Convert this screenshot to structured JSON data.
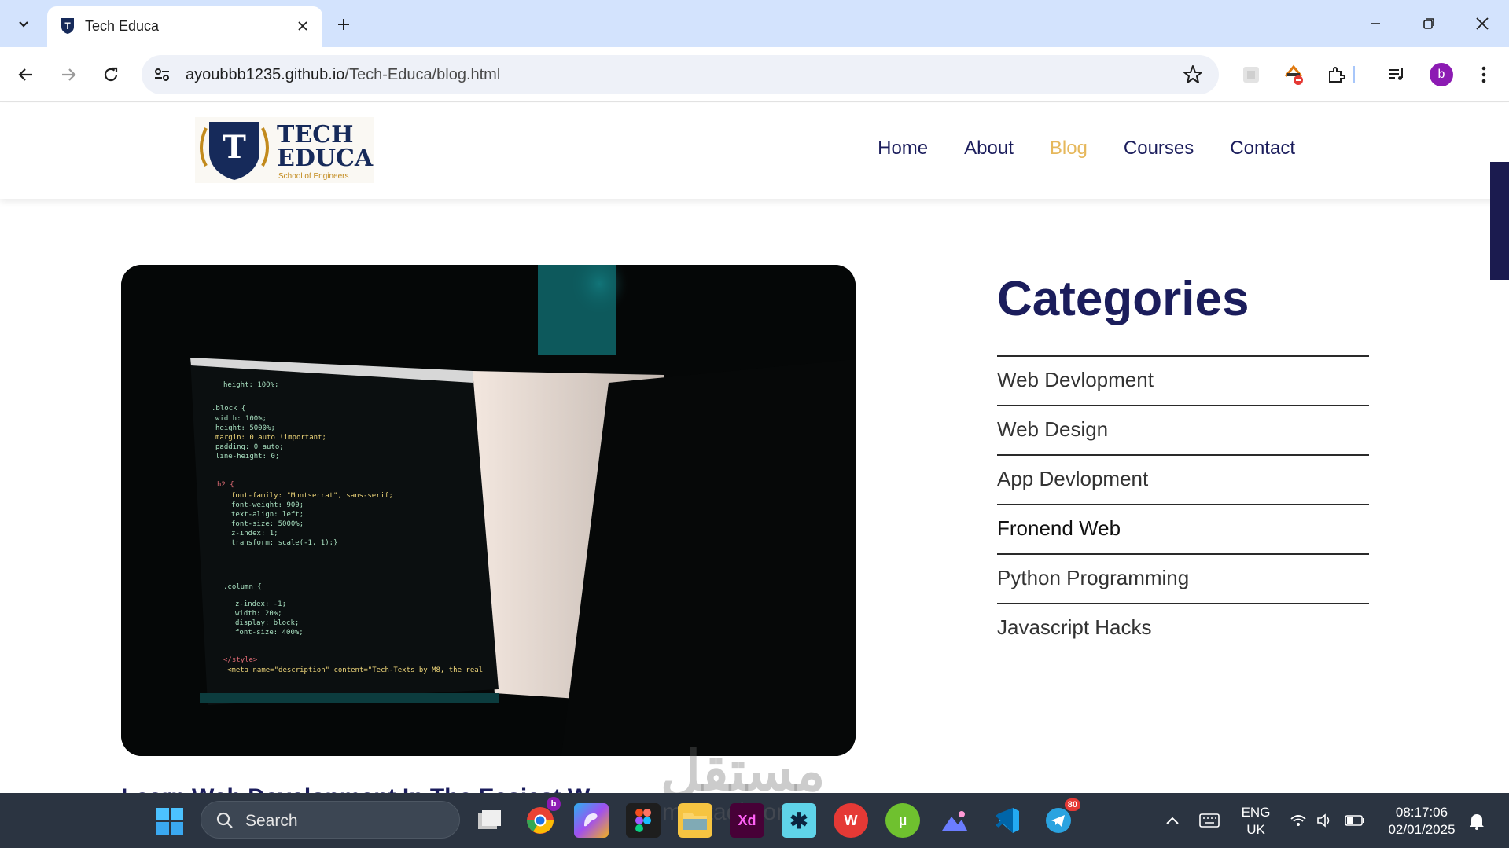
{
  "browser": {
    "tab_title": "Tech Educa",
    "url_host": "ayoubbb1235.github.io",
    "url_path": "/Tech-Educa/blog.html",
    "profile_initial": "b"
  },
  "site": {
    "logo_line1": "TECH",
    "logo_line2": "EDUCA",
    "logo_tagline": "School of Engineers",
    "logo_letter": "T",
    "nav": [
      {
        "label": "Home",
        "active": false
      },
      {
        "label": "About",
        "active": false
      },
      {
        "label": "Blog",
        "active": true
      },
      {
        "label": "Courses",
        "active": false
      },
      {
        "label": "Contact",
        "active": false
      }
    ]
  },
  "categories": {
    "title": "Categories",
    "items": [
      "Web Devlopment",
      "Web Design",
      "App Devlopment",
      "Fronend Web",
      "Python Programming",
      "Javascript Hacks"
    ]
  },
  "article": {
    "title_partial": "Learn Web Development In The Easiest W..."
  },
  "watermark": {
    "arabic": "مستقل",
    "latin": "mostaql.com"
  },
  "taskbar": {
    "search_label": "Search",
    "lang_line1": "ENG",
    "lang_line2": "UK",
    "time": "08:17:06",
    "date": "02/01/2025",
    "chrome_badge": "b",
    "telegram_badge": "80"
  },
  "colors": {
    "brand_navy": "#1b1d5c",
    "nav_active": "#e6b85c",
    "tabbar": "#d3e3fd",
    "taskbar": "#2b3441"
  }
}
